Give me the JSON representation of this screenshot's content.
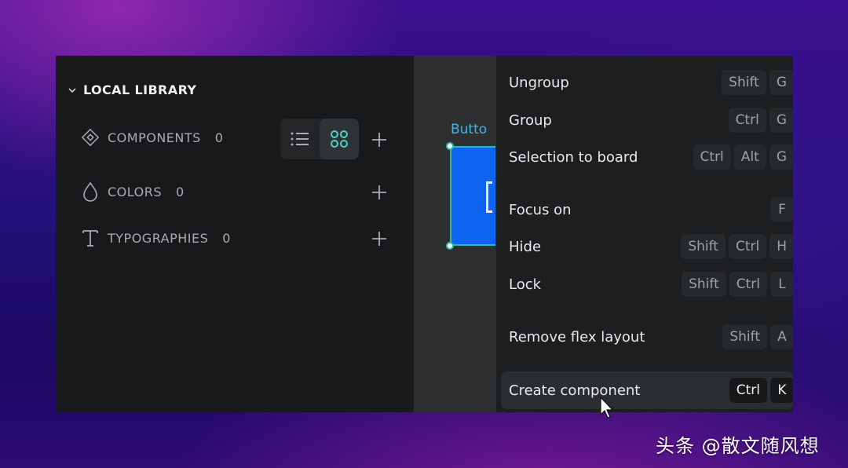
{
  "library": {
    "title": "LOCAL LIBRARY",
    "sections": [
      {
        "label": "COMPONENTS",
        "count": "0",
        "icon": "component-diamond-icon"
      },
      {
        "label": "COLORS",
        "count": "0",
        "icon": "color-drop-icon"
      },
      {
        "label": "TYPOGRAPHIES",
        "count": "0",
        "icon": "typography-t-icon"
      }
    ],
    "view_toggle": {
      "active": "grid"
    }
  },
  "canvas": {
    "board_label": "Butto"
  },
  "context_menu": {
    "items": [
      {
        "label": "Ungroup",
        "keys": [
          "Shift",
          "G"
        ]
      },
      {
        "label": "Group",
        "keys": [
          "Ctrl",
          "G"
        ]
      },
      {
        "label": "Selection to board",
        "keys": [
          "Ctrl",
          "Alt",
          "G"
        ]
      },
      {
        "label": "Focus on",
        "keys": [
          "F"
        ]
      },
      {
        "label": "Hide",
        "keys": [
          "Shift",
          "Ctrl",
          "H"
        ]
      },
      {
        "label": "Lock",
        "keys": [
          "Shift",
          "Ctrl",
          "L"
        ]
      },
      {
        "label": "Remove flex layout",
        "keys": [
          "Shift",
          "A"
        ]
      },
      {
        "label": "Create component",
        "keys": [
          "Ctrl",
          "K"
        ]
      }
    ],
    "highlighted_index": 7
  },
  "watermark": "头条 @散文随风想",
  "colors": {
    "accent_blue": "#0e63f0",
    "selection_teal": "#30bda8",
    "label_blue": "#3fb7e6"
  }
}
